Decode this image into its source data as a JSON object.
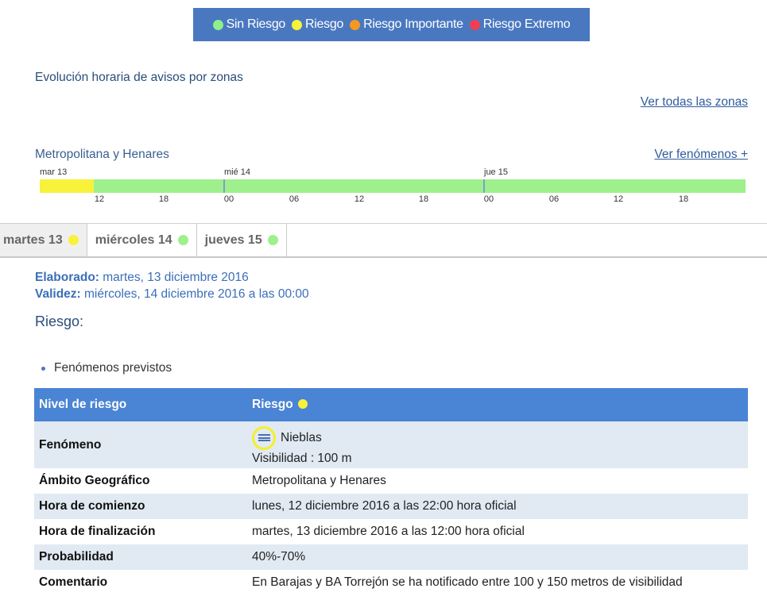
{
  "colors": {
    "sin_riesgo": "#9ef08c",
    "riesgo": "#f8f23a",
    "riesgo_importante": "#f49820",
    "riesgo_extremo": "#f04050",
    "header_blue": "#4a84d4"
  },
  "legend": [
    {
      "label": "Sin Riesgo",
      "color": "#8ef08a"
    },
    {
      "label": "Riesgo",
      "color": "#f8f23a"
    },
    {
      "label": "Riesgo Importante",
      "color": "#f49820"
    },
    {
      "label": "Riesgo Extremo",
      "color": "#f04050"
    }
  ],
  "section_title": "Evolución horaria de avisos por zonas",
  "link_all_zones": "Ver todas las zonas",
  "zone": {
    "name": "Metropolitana y Henares",
    "link_fenomenos": "Ver fenómenos +"
  },
  "timeline": {
    "days": [
      "mar 13",
      "mié 14",
      "jue 15"
    ],
    "hours": [
      "12",
      "18",
      "00",
      "06",
      "12",
      "18",
      "00",
      "06",
      "12",
      "18"
    ]
  },
  "tabs": [
    {
      "label": "martes 13",
      "color": "#f8f23a"
    },
    {
      "label": "miércoles 14",
      "color": "#9ef08c"
    },
    {
      "label": "jueves 15",
      "color": "#9ef08c"
    }
  ],
  "meta": {
    "elaborado_label": "Elaborado:",
    "elaborado_value": " martes, 13 diciembre 2016",
    "validez_label": "Validez:",
    "validez_value": " miércoles, 14 diciembre 2016 a las 00:00"
  },
  "riesgo_heading": "Riesgo:",
  "bullet": "Fenómenos previstos",
  "table": {
    "header": {
      "label": "Nivel de riesgo",
      "value": "Riesgo"
    },
    "fenomeno": {
      "label": "Fenómeno",
      "name": "Nieblas",
      "detail": "Visibilidad : 100 m",
      "icon": "fog-icon"
    },
    "rows": [
      {
        "label": "Ámbito Geográfico",
        "value": "Metropolitana y Henares"
      },
      {
        "label": "Hora de comienzo",
        "value": "lunes, 12 diciembre 2016 a las 22:00 hora oficial"
      },
      {
        "label": "Hora de finalización",
        "value": "martes, 13 diciembre 2016 a las 12:00 hora oficial"
      },
      {
        "label": "Probabilidad",
        "value": "40%-70%"
      },
      {
        "label": "Comentario",
        "value": "En Barajas y BA Torrejón se ha notificado entre 100 y 150 metros de visibilidad"
      }
    ]
  }
}
